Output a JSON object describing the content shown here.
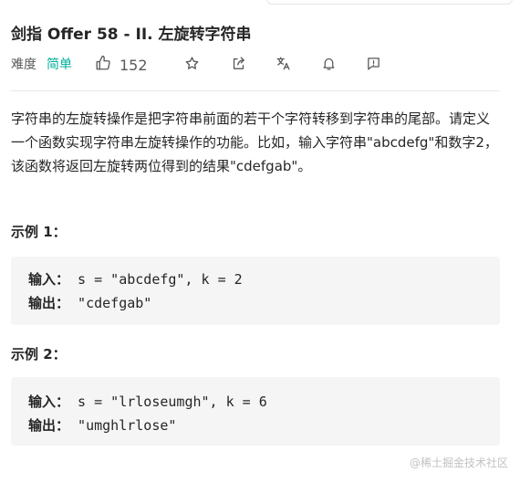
{
  "problem": {
    "title": "剑指 Offer 58 - II. 左旋转字符串",
    "difficulty_label": "难度",
    "difficulty": "简单",
    "likes": "152",
    "description": "字符串的左旋转操作是把字符串前面的若干个字符转移到字符串的尾部。请定义一个函数实现字符串左旋转操作的功能。比如，输入字符串\"abcdefg\"和数字2，该函数将返回左旋转两位得到的结果\"cdefgab\"。"
  },
  "toolbar_icons": [
    "thumbs-up-icon",
    "star-icon",
    "share-icon",
    "translate-icon",
    "bell-icon",
    "feedback-icon"
  ],
  "examples": [
    {
      "title": "示例 1：",
      "input_label": "输入：",
      "input": " s = \"abcdefg\", k = 2",
      "output_label": "输出：",
      "output": " \"cdefgab\""
    },
    {
      "title": "示例 2：",
      "input_label": "输入：",
      "input": " s = \"lrloseumgh\", k = 6",
      "output_label": "输出：",
      "output": " \"umghlrlose\""
    }
  ],
  "watermark": "@稀土掘金技术社区",
  "colors": {
    "easy": "#00af9b",
    "code_bg": "#f5f5f5",
    "text": "#262626",
    "muted": "#595959"
  }
}
